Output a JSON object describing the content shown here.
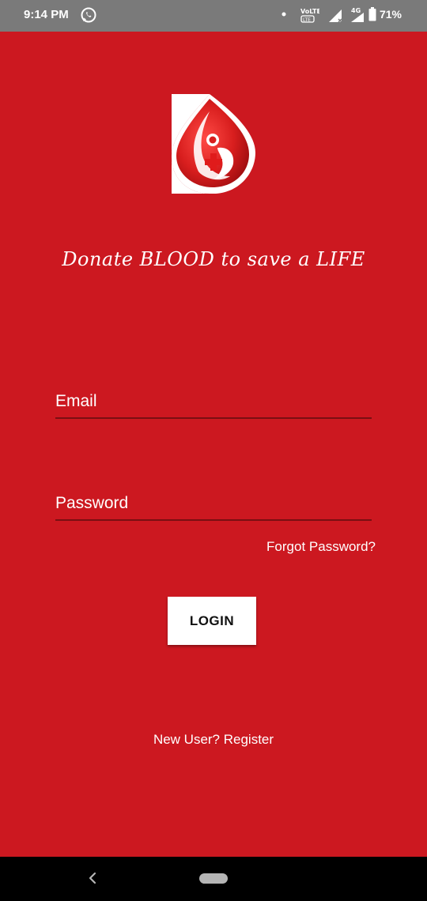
{
  "status_bar": {
    "time": "9:14 PM",
    "battery": "71%",
    "network": "4G"
  },
  "branding": {
    "tagline": "Donate BLOOD to save a LIFE"
  },
  "form": {
    "email_placeholder": "Email",
    "password_placeholder": "Password",
    "forgot_label": "Forgot Password?",
    "login_label": "LOGIN",
    "register_label": "New User? Register"
  },
  "colors": {
    "background": "#cc1820",
    "button": "#ffffff",
    "underline": "#7a0f12"
  }
}
